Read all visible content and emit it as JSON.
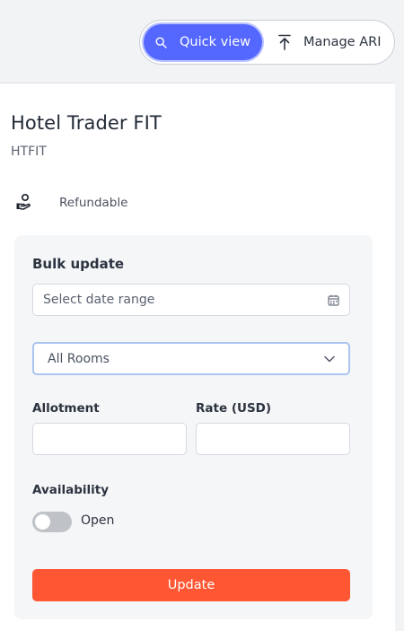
{
  "header": {
    "quick_view_label": "Quick view",
    "manage_ari_label": "Manage ARI",
    "quick_view_icon": "search-icon",
    "manage_ari_icon": "upload-arrow-icon",
    "accent_color": "#5468ff"
  },
  "hotel": {
    "name": "Hotel Trader FIT",
    "code": "HTFIT",
    "policy_icon": "hand-coin-icon",
    "policy_label": "Refundable"
  },
  "bulk_update": {
    "title": "Bulk update",
    "date_range_placeholder": "Select date range",
    "date_icon": "calendar-icon",
    "room_select_value": "All Rooms",
    "room_select_icon": "chevron-down-icon",
    "allotment_label": "Allotment",
    "allotment_value": "",
    "rate_label": "Rate (USD)",
    "rate_value": "",
    "availability_label": "Availability",
    "availability_toggle_on": false,
    "availability_state_label": "Open",
    "update_button_label": "Update",
    "update_button_color": "#ff5733"
  }
}
